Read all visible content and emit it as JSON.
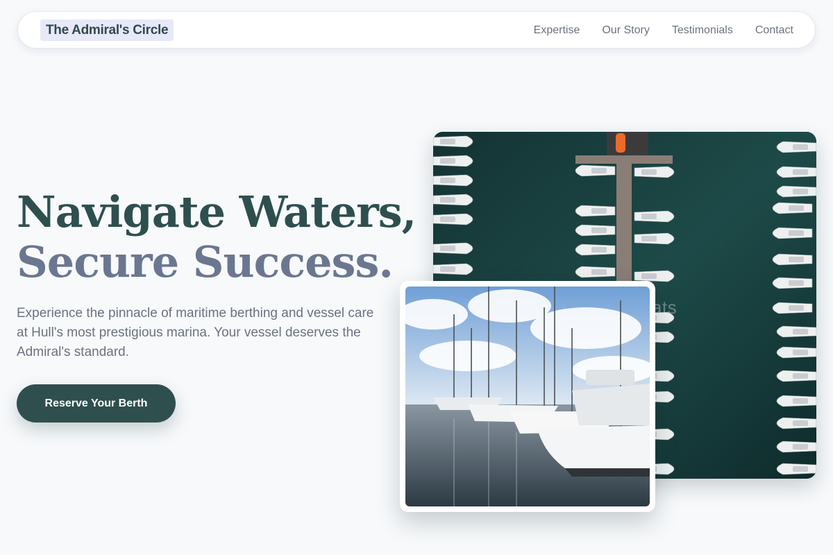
{
  "nav": {
    "brand": "The Admiral's Circle",
    "links": [
      "Expertise",
      "Our Story",
      "Testimonials",
      "Contact"
    ]
  },
  "hero": {
    "headline_line1": "Navigate Waters,",
    "headline_line2": "Secure Success.",
    "lede": "Experience the pinnacle of maritime berthing and vessel care at Hull's most prestigious marina. Your vessel deserves the Admiral's standard.",
    "cta_label": "Reserve Your Berth"
  },
  "images": {
    "aerial_ghost_caption": "oats"
  },
  "colors": {
    "primary": "#2f4f4f",
    "secondary_heading": "#6b7790",
    "muted_text": "#6b7280",
    "brand_highlight": "#e7e8f8",
    "page_background": "#f7f9fb"
  }
}
